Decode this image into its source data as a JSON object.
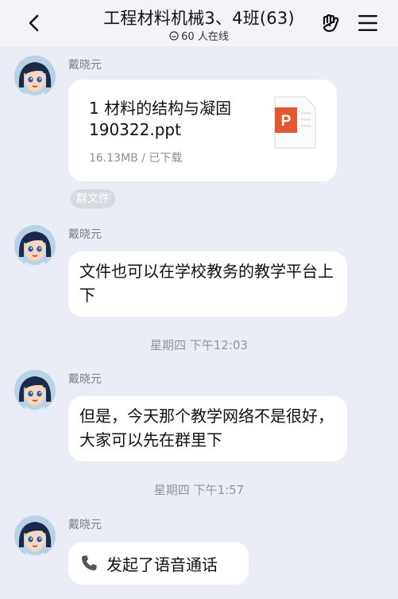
{
  "header": {
    "title": "工程材料机械3、4班(63)",
    "online": "60 人在线"
  },
  "messages": [
    {
      "sender": "戴晓元",
      "file": {
        "name": "1  材料的结构与凝固190322.ppt",
        "size": "16.13MB",
        "status": "已下载"
      },
      "tag": "群文件"
    },
    {
      "sender": "戴晓元",
      "text": "文件也可以在学校教务的教学平台上下"
    },
    {
      "sender": "戴晓元",
      "text": "但是，今天那个教学网络不是很好，大家可以先在群里下"
    },
    {
      "sender": "戴晓元",
      "call": "发起了语音通话"
    }
  ],
  "times": [
    "星期四 下午12:03",
    "星期四 下午1:57"
  ],
  "file_meta_line": "16.13MB / 已下载",
  "colors": {
    "background": "#eaedf5",
    "header_bg": "#f4f4f8",
    "ppt_orange": "#e4582f"
  }
}
